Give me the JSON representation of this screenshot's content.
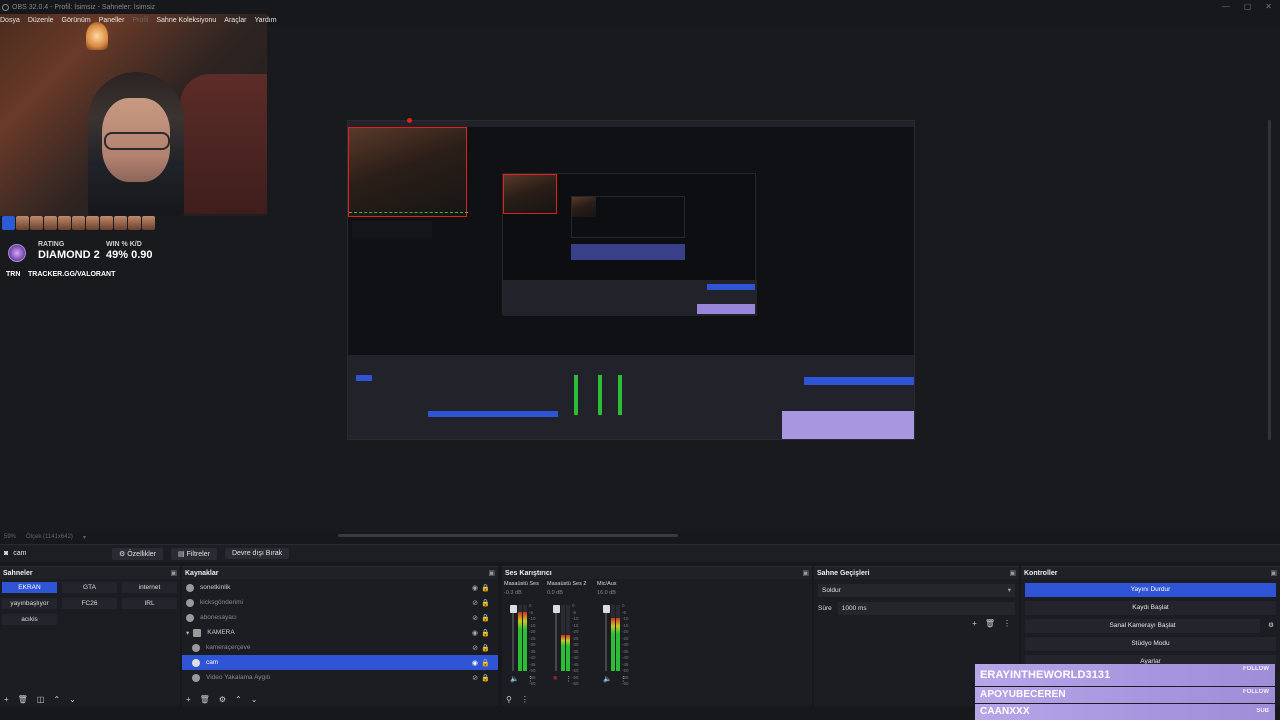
{
  "window": {
    "title": "OBS 32.0.4 - Profil: İsimsiz - Sahneler: İsimsiz",
    "controls": [
      "—",
      "▢",
      "✕"
    ]
  },
  "menu": [
    "Dosya",
    "Düzenle",
    "Görünüm",
    "Paneller",
    "Profil",
    "Sahne Koleksiyonu",
    "Araçlar",
    "Yardım"
  ],
  "overlay": {
    "rating_label": "RATING",
    "rating_value": "DIAMOND 2",
    "win_label": "WIN % K/D",
    "win_value": "49% 0.90",
    "trn_logo": "TRN",
    "trn_url": "TRACKER.GG/VALORANT"
  },
  "preview_status": {
    "zoom": "59%",
    "scale": "Ölçek (1141x642)"
  },
  "context_bar": {
    "source_name": "cam",
    "properties": "Özellikler",
    "filters": "Filtreler",
    "deactivate": "Devre dışı Bırak"
  },
  "scenes": {
    "title": "Sahneler",
    "items": [
      "EKRAN",
      "GTA",
      "internet",
      "yayınbaşlıyor",
      "FC26",
      "IRL",
      "acıkis"
    ],
    "active": "EKRAN"
  },
  "sources": {
    "title": "Kaynaklar",
    "items": [
      {
        "label": "sonetkinlik",
        "visible": true
      },
      {
        "label": "kicksgönderimi",
        "visible": false
      },
      {
        "label": "abonesayacı",
        "visible": false
      },
      {
        "label": "KAMERA",
        "visible": true,
        "folder": true
      },
      {
        "label": "kameraçerçeve",
        "visible": false
      },
      {
        "label": "cam",
        "visible": true,
        "active": true
      },
      {
        "label": "Video Yakalama Aygıtı",
        "visible": false
      }
    ]
  },
  "mixer": {
    "title": "Ses Karıştırıcı",
    "channels": [
      {
        "name": "Masaüstü Ses",
        "db": "-0.3 dB",
        "level": 0.9
      },
      {
        "name": "Masaüstü Ses 2",
        "db": "0.0 dB",
        "level": 0.55
      },
      {
        "name": "Mic/Aux",
        "db": "16.0 dB",
        "level": 0.8
      }
    ],
    "scale": [
      "0",
      "-5",
      "-10",
      "-15",
      "-20",
      "-25",
      "-30",
      "-35",
      "-40",
      "-45",
      "-50",
      "-55",
      "-60"
    ]
  },
  "transitions": {
    "title": "Sahne Geçişleri",
    "selected": "Soldur",
    "duration_label": "Süre",
    "duration_value": "1000 ms"
  },
  "controls": {
    "title": "Kontroller",
    "buttons": [
      "Yayını Durdur",
      "Kaydı Başlat",
      "Sanal Kamerayı Başlat",
      "Stüdyo Modu",
      "Ayarlar"
    ]
  },
  "alerts": [
    {
      "name": "ERAYINTHEWORLD3131",
      "type": "FOLLOW"
    },
    {
      "name": "APOYUBECEREN",
      "type": "FOLLOW"
    },
    {
      "name": "CAANXXX",
      "type": "SUB"
    }
  ],
  "colors": {
    "accent": "#2f55d6",
    "alert_purple": "#a896e0",
    "selection_red": "#e02020",
    "meter_green": "#2bbd35"
  }
}
